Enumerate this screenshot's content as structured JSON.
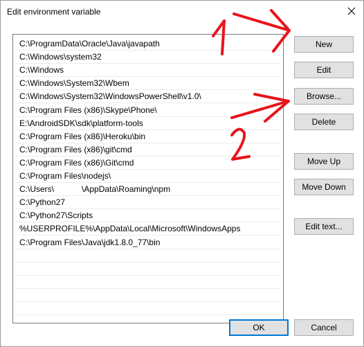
{
  "window": {
    "title": "Edit environment variable"
  },
  "paths": [
    "C:\\ProgramData\\Oracle\\Java\\javapath",
    "C:\\Windows\\system32",
    "C:\\Windows",
    "C:\\Windows\\System32\\Wbem",
    "C:\\Windows\\System32\\WindowsPowerShell\\v1.0\\",
    "C:\\Program Files (x86)\\Skype\\Phone\\",
    "E:\\AndroidSDK\\sdk\\platform-tools",
    "C:\\Program Files (x86)\\Heroku\\bin",
    "C:\\Program Files (x86)\\git\\cmd",
    "C:\\Program Files (x86)\\Git\\cmd",
    "C:\\Program Files\\nodejs\\",
    "C:\\Users\\            \\AppData\\Roaming\\npm",
    "C:\\Python27",
    "C:\\Python27\\Scripts",
    "%USERPROFILE%\\AppData\\Local\\Microsoft\\WindowsApps",
    "C:\\Program Files\\Java\\jdk1.8.0_77\\bin"
  ],
  "buttons": {
    "new": "New",
    "edit": "Edit",
    "browse": "Browse...",
    "delete": "Delete",
    "move_up": "Move Up",
    "move_down": "Move Down",
    "edit_text": "Edit text...",
    "ok": "OK",
    "cancel": "Cancel"
  },
  "annotations": {
    "step1": "1",
    "step2": "2",
    "color": "#e8141c"
  }
}
